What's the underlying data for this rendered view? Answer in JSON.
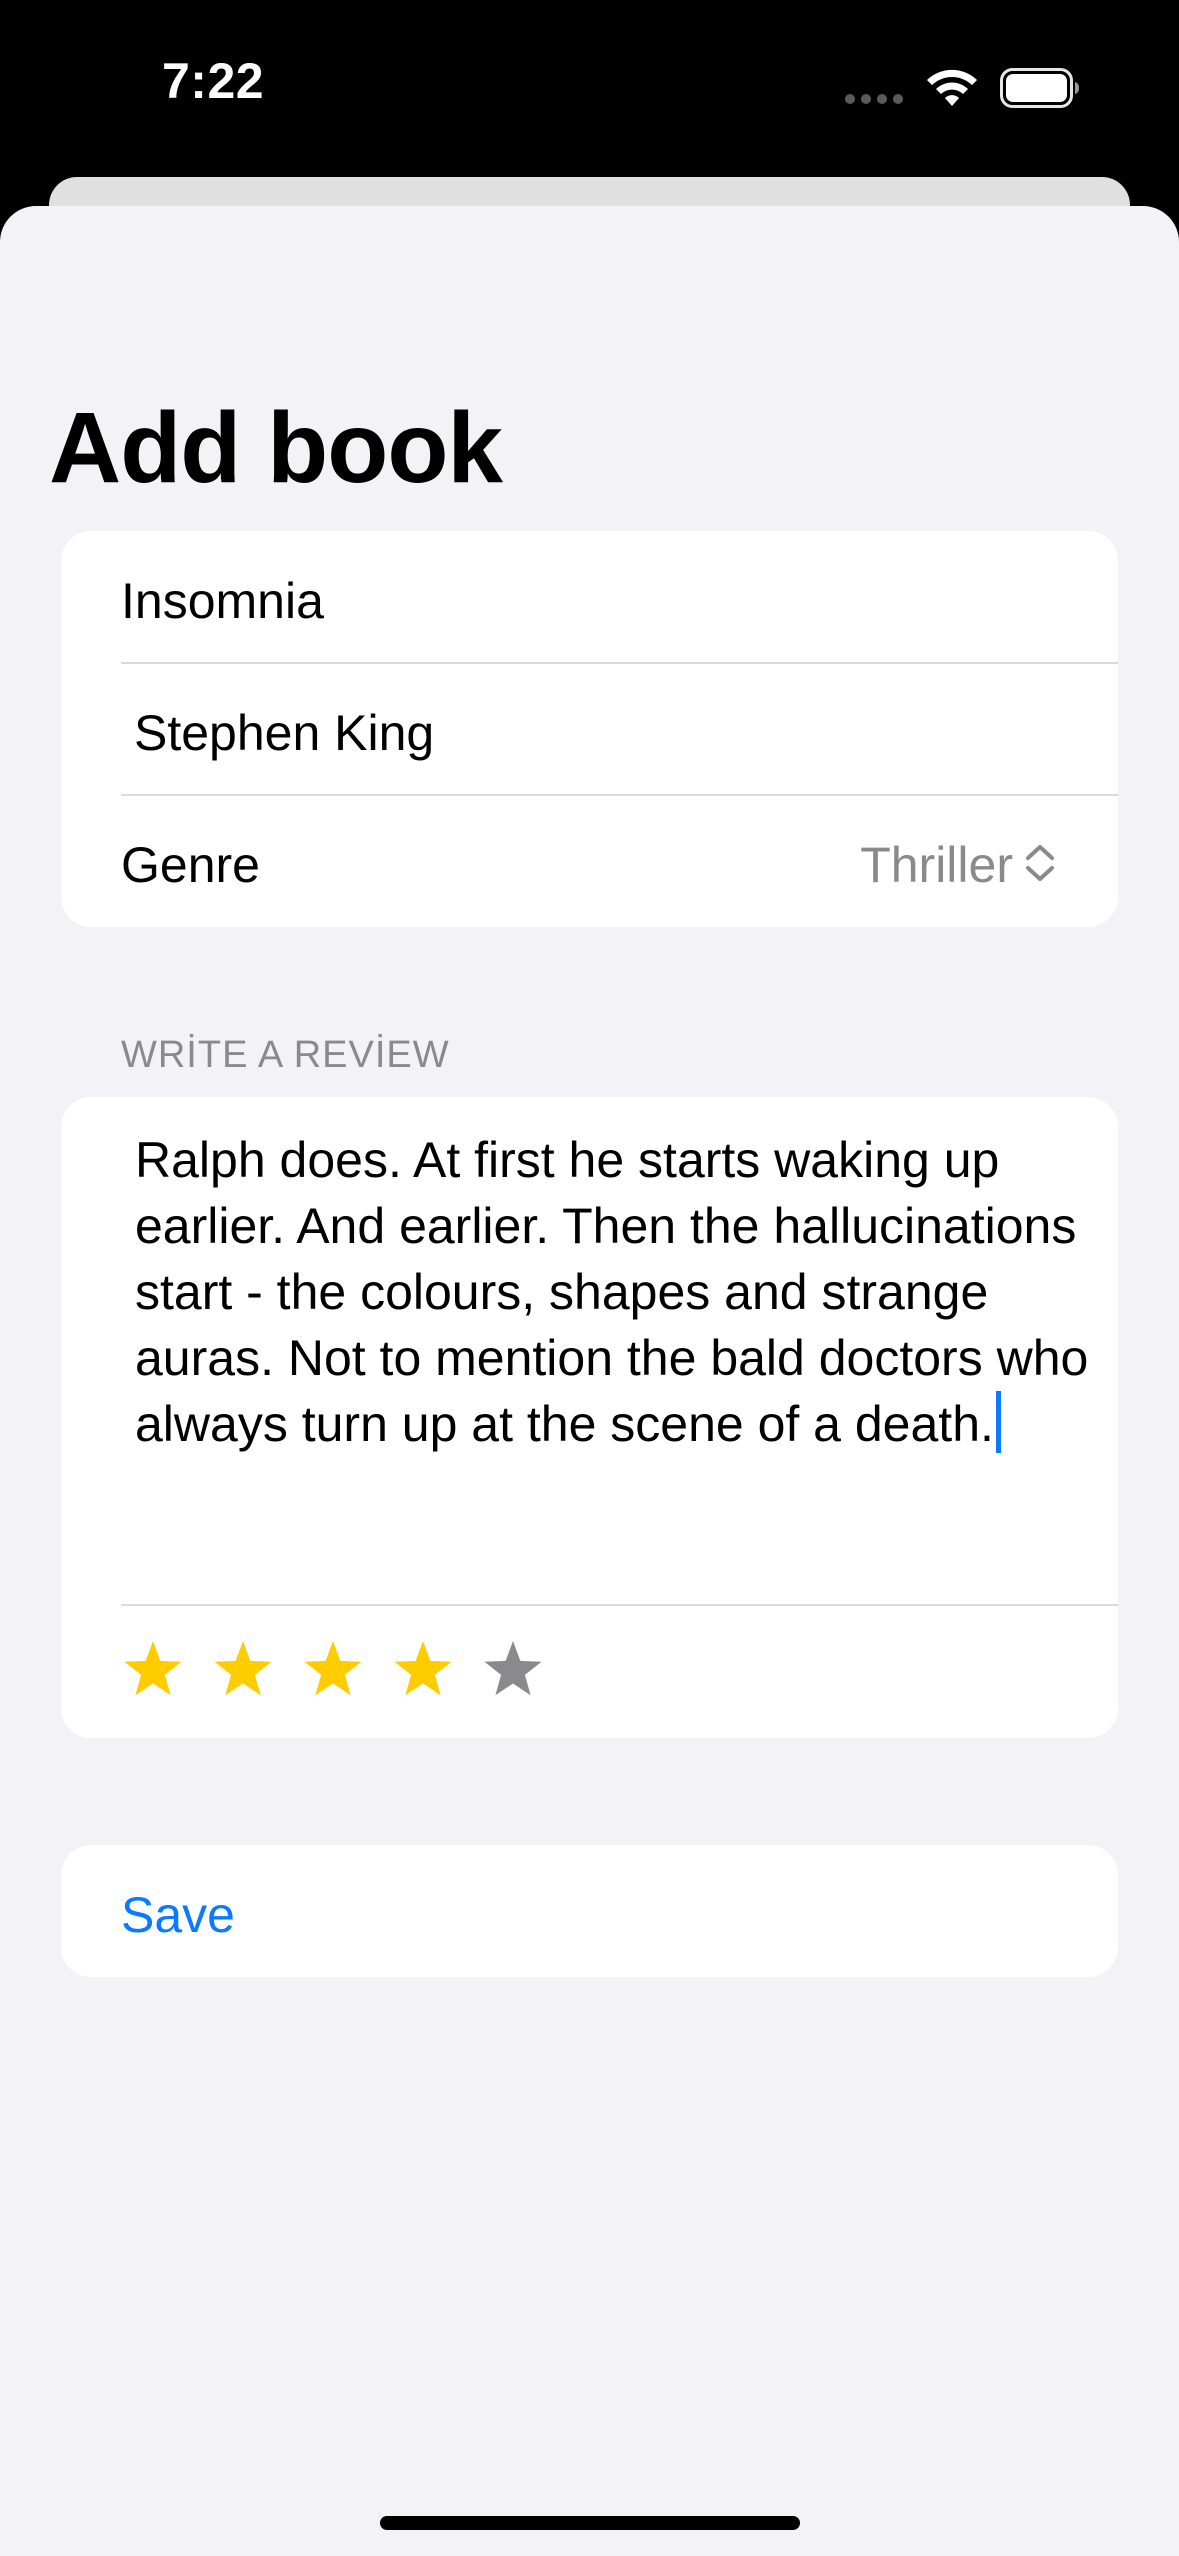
{
  "status_bar": {
    "time": "7:22",
    "icons": [
      "cellular-dots-icon",
      "wifi-icon",
      "battery-icon"
    ]
  },
  "page": {
    "title": "Add book"
  },
  "form": {
    "title_value": "Insomnia",
    "author_value": "Stephen King",
    "genre_label": "Genre",
    "genre_value": "Thriller",
    "genre_icon": "chevron-up-down-icon"
  },
  "review": {
    "section_header": "WRİTE A REVİEW",
    "text": "Ralph does. At first he starts waking up earlier. And earlier. Then the hallucinations start - the colours, shapes and strange auras. Not to mention the bald doctors who always turn up at the scene of a death.",
    "rating": 4,
    "rating_max": 5
  },
  "actions": {
    "save_label": "Save"
  },
  "colors": {
    "accent": "#0A7AFF",
    "star_filled": "#FFCC00",
    "star_empty": "#8A8A8E",
    "background": "#F2F2F7"
  }
}
